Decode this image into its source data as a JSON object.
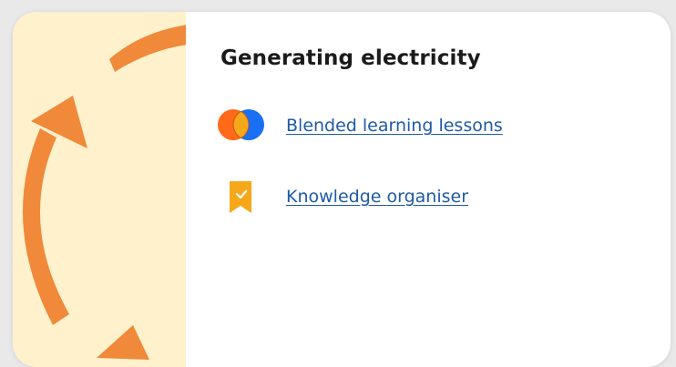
{
  "card": {
    "title": "Generating electricity",
    "resources": [
      {
        "label": "Blended learning lessons",
        "icon": "blended-learning-icon"
      },
      {
        "label": "Knowledge organiser",
        "icon": "bookmark-check-icon"
      }
    ]
  },
  "colors": {
    "panel_background": "#fff1cc",
    "arrow": "#f0893a",
    "link": "#1f5aa6",
    "blended_orange": "#ff6a1a",
    "blended_blue": "#1a6ff2",
    "bookmark": "#f6a81a"
  }
}
